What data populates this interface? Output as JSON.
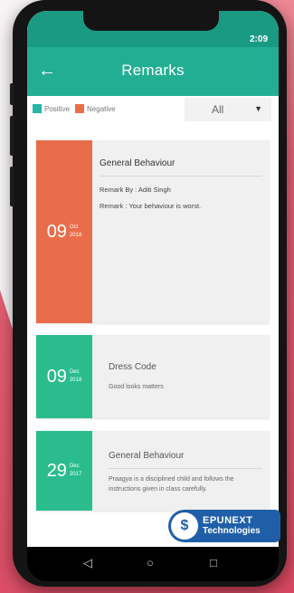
{
  "status_bar": {
    "time": "2:09"
  },
  "app_bar": {
    "back_icon": "arrow-left-icon",
    "title": "Remarks"
  },
  "legend": {
    "positive": {
      "label": "Positive",
      "color": "#25b6a6"
    },
    "negative": {
      "label": "Negative",
      "color": "#e96d4a"
    }
  },
  "filter": {
    "selected": "All",
    "icon": "caret-down-icon"
  },
  "remarks": [
    {
      "day": "09",
      "month": "Oct",
      "year": "2018",
      "title": "General Behaviour",
      "remark_by": "Remark By : Aditi Singh",
      "remark": "Remark : Your behaviour is worst.",
      "type": "negative",
      "color": "#e96d4a"
    },
    {
      "day": "09",
      "month": "Dec",
      "year": "2018",
      "title": "Dress Code",
      "text": "Good looks matters",
      "type": "positive",
      "color": "#2bbc8d"
    },
    {
      "day": "29",
      "month": "Dec",
      "year": "2017",
      "title": "General Behaviour",
      "text": "Praagya is a disciplined child and follows the instructions given in class carefully.",
      "type": "positive",
      "color": "#2bbc8d"
    }
  ],
  "nav": {
    "back": "◁",
    "home": "○",
    "recents": "□"
  },
  "watermark": {
    "line1": "EPUNEXT",
    "line2": "Technologies"
  }
}
